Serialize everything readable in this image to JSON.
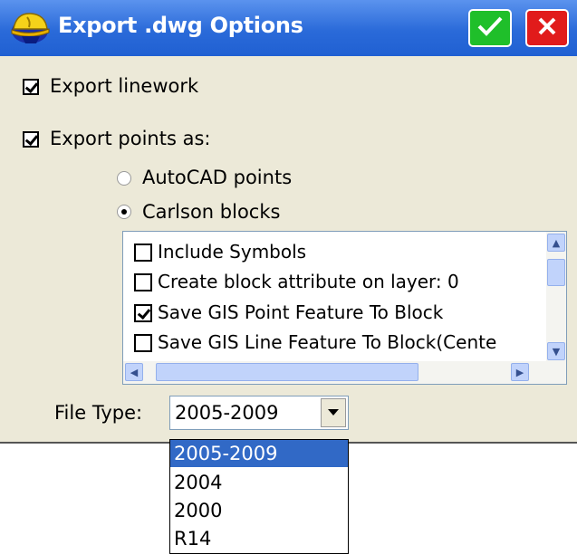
{
  "window": {
    "title": "Export .dwg Options",
    "app_icon": "surveyor-helmet-icon",
    "ok_icon": "checkmark-icon",
    "close_icon": "x-icon",
    "colors": {
      "titlebar": "#2a6ad9",
      "ok": "#1fbf2a",
      "close": "#e11b1b",
      "selection": "#3169c6"
    }
  },
  "options": {
    "export_linework": {
      "label": "Export linework",
      "checked": true
    },
    "export_points": {
      "label": "Export points as:",
      "checked": true
    }
  },
  "point_format": {
    "autocad": {
      "label": "AutoCAD points",
      "selected": false
    },
    "carlson": {
      "label": "Carlson blocks",
      "selected": true
    }
  },
  "block_options": [
    {
      "label": "Include Symbols",
      "checked": false
    },
    {
      "label": "Create block attribute on layer: 0",
      "checked": false
    },
    {
      "label": "Save GIS Point Feature To Block",
      "checked": true
    },
    {
      "label": "Save GIS Line Feature To Block(Cente",
      "checked": false
    }
  ],
  "file_type": {
    "label": "File Type:",
    "value": "2005-2009",
    "options": [
      "2005-2009",
      "2004",
      "2000",
      "R14"
    ]
  }
}
